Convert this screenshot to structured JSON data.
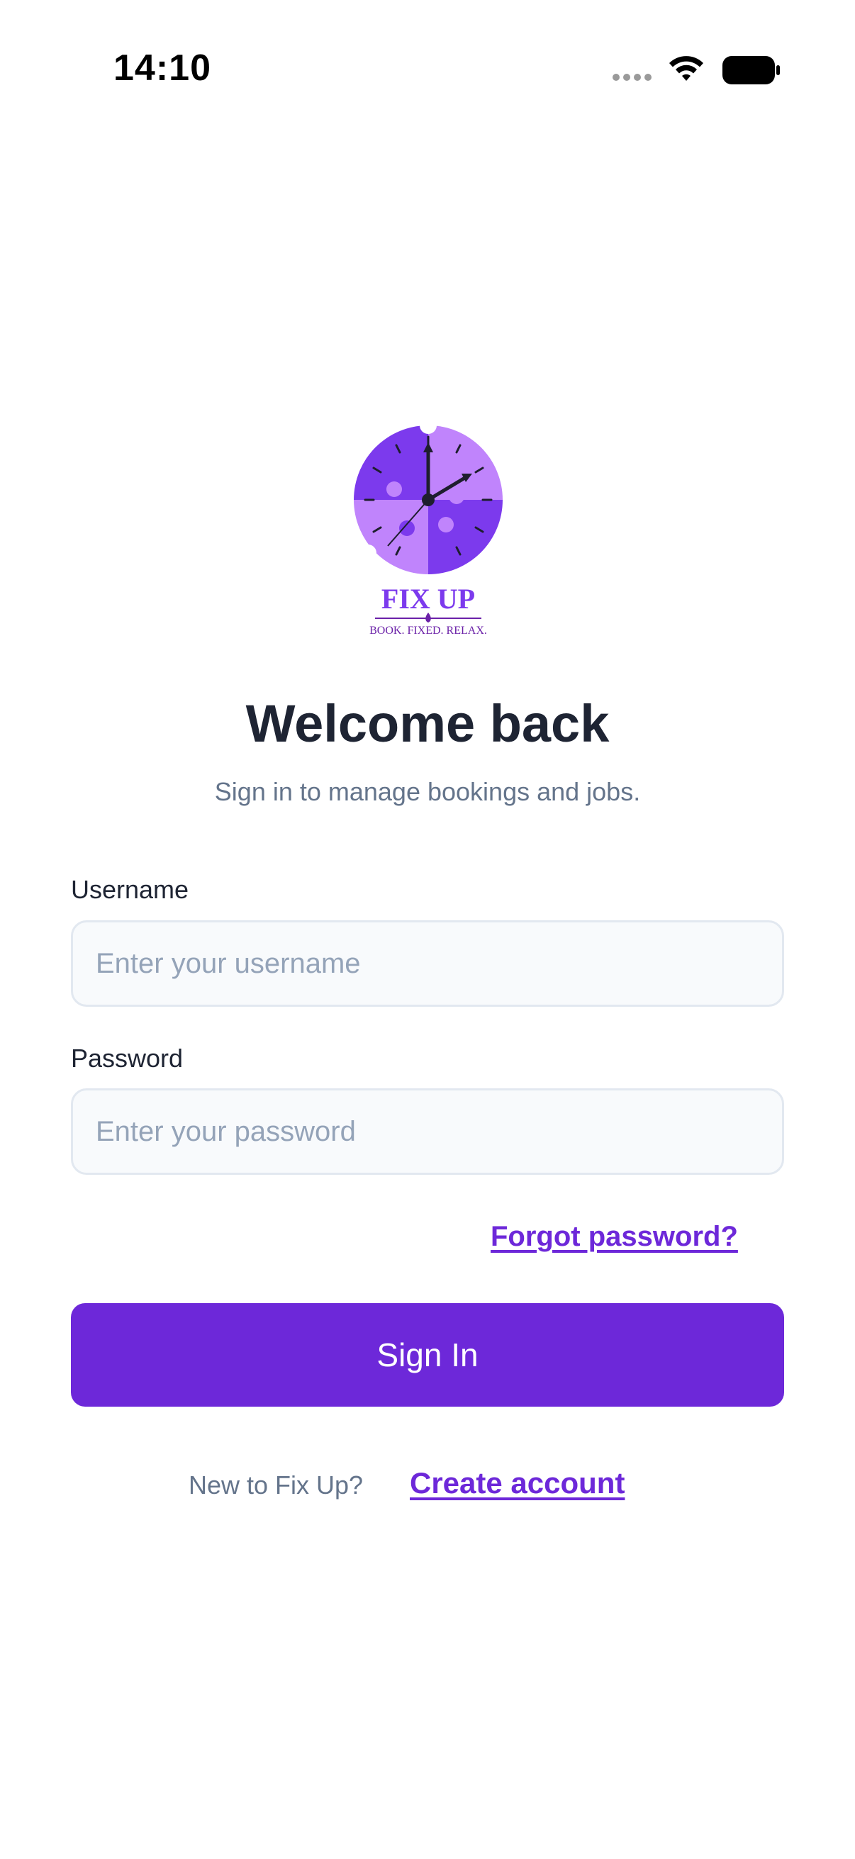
{
  "status_bar": {
    "time": "14:10",
    "icons": [
      "signal-dots-icon",
      "wifi-icon",
      "battery-icon"
    ]
  },
  "logo": {
    "brand": "FIX UP",
    "tagline": "BOOK. FIXED. RELAX."
  },
  "header": {
    "title": "Welcome back",
    "subtitle": "Sign in to manage bookings and jobs."
  },
  "form": {
    "username_label": "Username",
    "username_placeholder": "Enter your username",
    "username_value": "",
    "password_label": "Password",
    "password_placeholder": "Enter your password",
    "password_value": "",
    "forgot_password": "Forgot password?",
    "submit_label": "Sign In"
  },
  "footer": {
    "prompt": "New to Fix Up?",
    "create_account": "Create account"
  },
  "colors": {
    "accent": "#6d28d9",
    "logo_dark": "#7c3aed",
    "logo_light": "#c084fc",
    "text": "#1e2433",
    "muted": "#64748b",
    "input_bg": "#f8fafc",
    "input_border": "#e2e8f0"
  }
}
